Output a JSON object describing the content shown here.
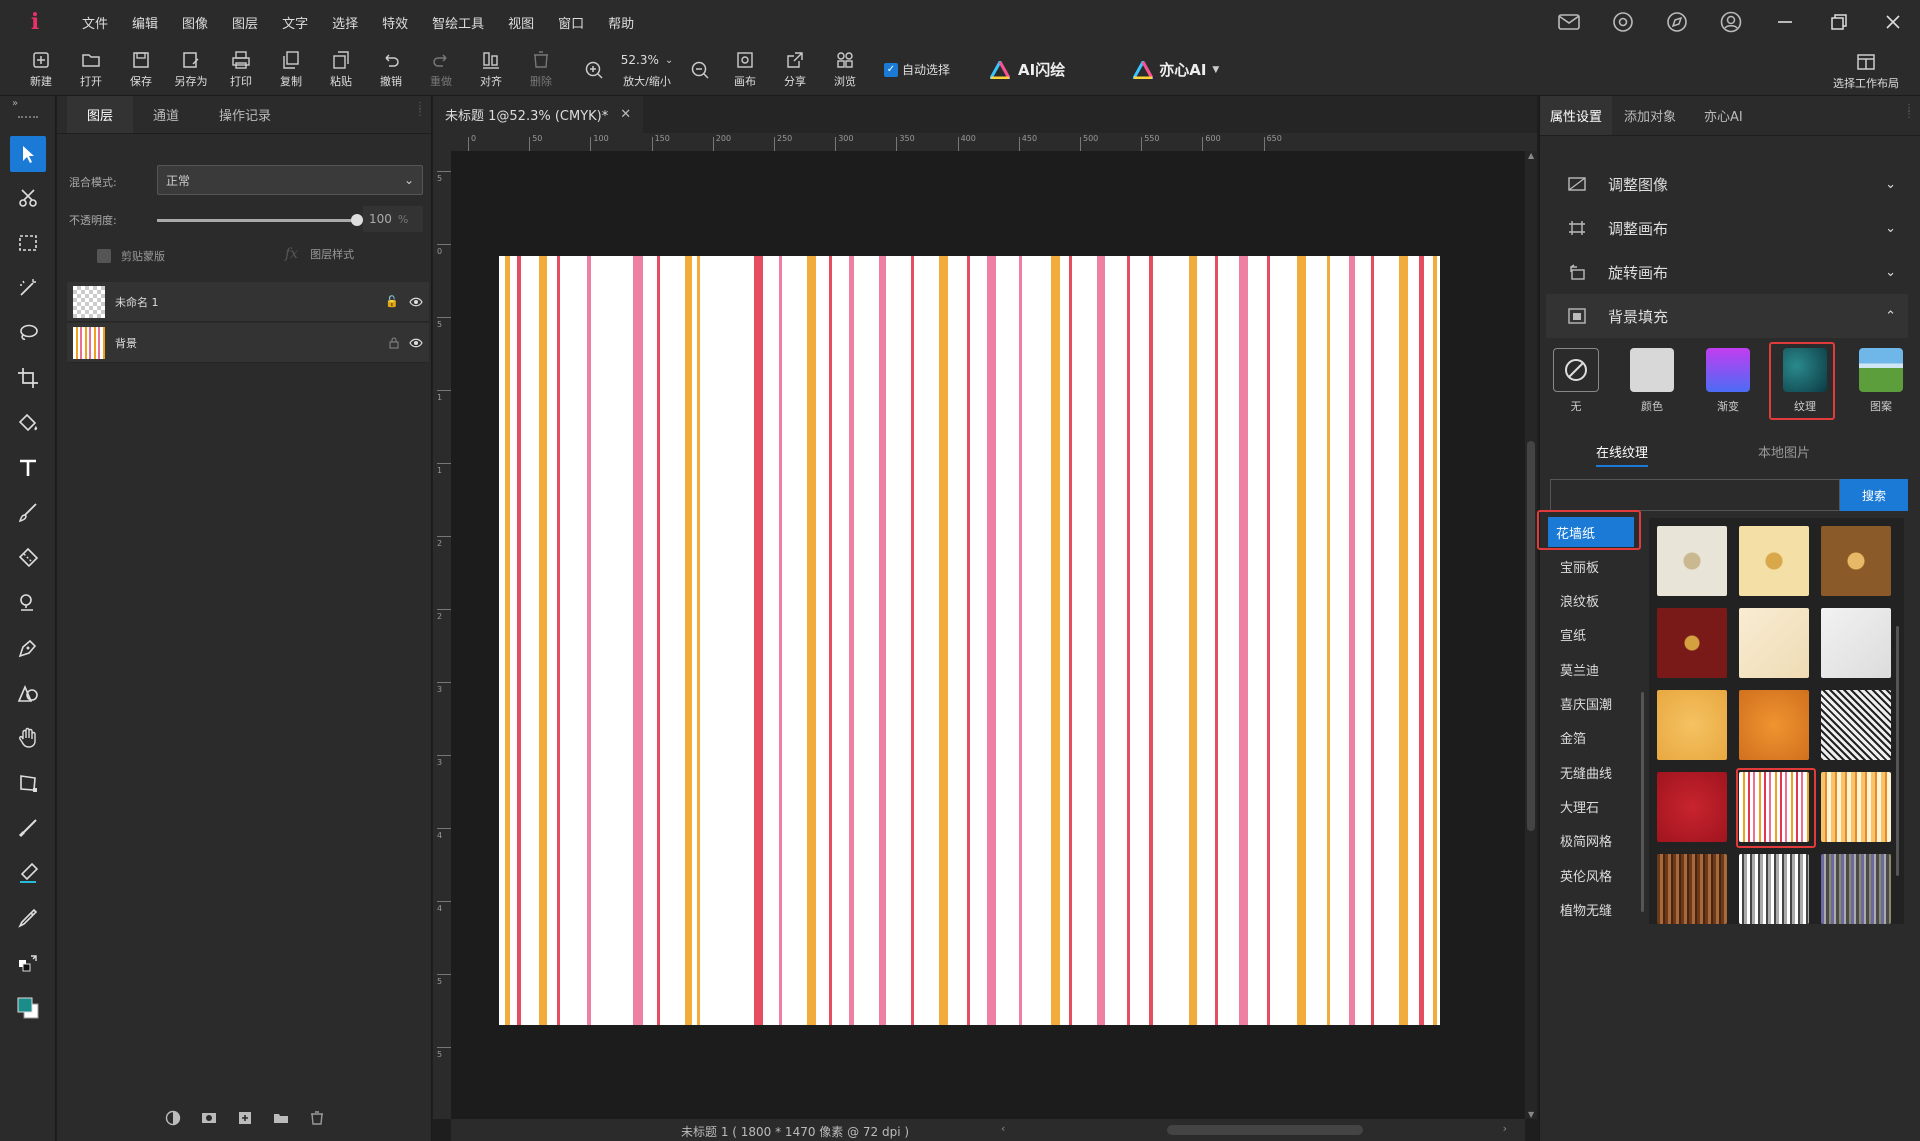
{
  "app": {
    "logo": "i"
  },
  "menu": [
    "文件",
    "编辑",
    "图像",
    "图层",
    "文字",
    "选择",
    "特效",
    "智绘工具",
    "视图",
    "窗口",
    "帮助"
  ],
  "toolbar": {
    "buttons": [
      {
        "id": "new",
        "label": "新建"
      },
      {
        "id": "open",
        "label": "打开"
      },
      {
        "id": "save",
        "label": "保存"
      },
      {
        "id": "saveas",
        "label": "另存为"
      },
      {
        "id": "print",
        "label": "打印"
      },
      {
        "id": "copy",
        "label": "复制"
      },
      {
        "id": "paste",
        "label": "粘贴"
      },
      {
        "id": "undo",
        "label": "撤销"
      },
      {
        "id": "redo",
        "label": "重做"
      },
      {
        "id": "align",
        "label": "对齐"
      },
      {
        "id": "delete",
        "label": "删除"
      }
    ],
    "zoom_value": "52.3%",
    "zoom_label": "放大/缩小",
    "buttons2": [
      {
        "id": "canvas",
        "label": "画布"
      },
      {
        "id": "share",
        "label": "分享"
      },
      {
        "id": "browse",
        "label": "浏览"
      }
    ],
    "auto_select": "自动选择",
    "auto_select_checked": true,
    "ai_draw": "AI闪绘",
    "yixin_ai": "亦心AI",
    "workspace": "选择工作布局"
  },
  "layers_panel": {
    "tabs": [
      "图层",
      "通道",
      "操作记录"
    ],
    "blend_label": "混合模式:",
    "blend_value": "正常",
    "opacity_label": "不透明度:",
    "opacity_value": "100",
    "opacity_unit": "%",
    "opacity_level": 1.0,
    "clip_label": "剪贴蒙版",
    "style_label": "图层样式",
    "layers": [
      {
        "name": "未命名 1"
      },
      {
        "name": "背景"
      }
    ]
  },
  "document": {
    "tab_title": "未标题 1@52.3% (CMYK)*",
    "ruler_top": [
      "0",
      "50",
      "100",
      "150",
      "200",
      "250",
      "300",
      "350",
      "400",
      "450",
      "500",
      "550",
      "600",
      "650"
    ],
    "ruler_left": [
      "5",
      "0",
      "5",
      "1",
      "1",
      "2",
      "2",
      "3",
      "3",
      "4",
      "4",
      "5",
      "5"
    ],
    "status": "未标题 1 ( 1800 * 1470 像素 @ 72 dpi )"
  },
  "right_panel": {
    "tabs": [
      "属性设置",
      "添加对象",
      "亦心AI"
    ],
    "sections": [
      {
        "label": "调整图像"
      },
      {
        "label": "调整画布"
      },
      {
        "label": "旋转画布"
      },
      {
        "label": "背景填充"
      }
    ],
    "fill_options": [
      {
        "label": "无"
      },
      {
        "label": "颜色"
      },
      {
        "label": "渐变"
      },
      {
        "label": "纹理"
      },
      {
        "label": "图案"
      }
    ],
    "selected_fill": "纹理",
    "subtabs": [
      "在线纹理",
      "本地图片"
    ],
    "search_button": "搜索",
    "search_value": "",
    "categories": [
      "花墙纸",
      "宝丽板",
      "浪纹板",
      "宣纸",
      "莫兰迪",
      "喜庆国潮",
      "金箔",
      "无缝曲线",
      "大理石",
      "极简网格",
      "英伦风格",
      "植物无缝"
    ],
    "selected_category": "花墙纸"
  },
  "colors": {
    "accent": "#1a7ad6",
    "highlight": "#e23b3b",
    "stripe_orange": "#f0a020",
    "stripe_red": "#e0364a",
    "stripe_pink": "#ea6e96"
  }
}
